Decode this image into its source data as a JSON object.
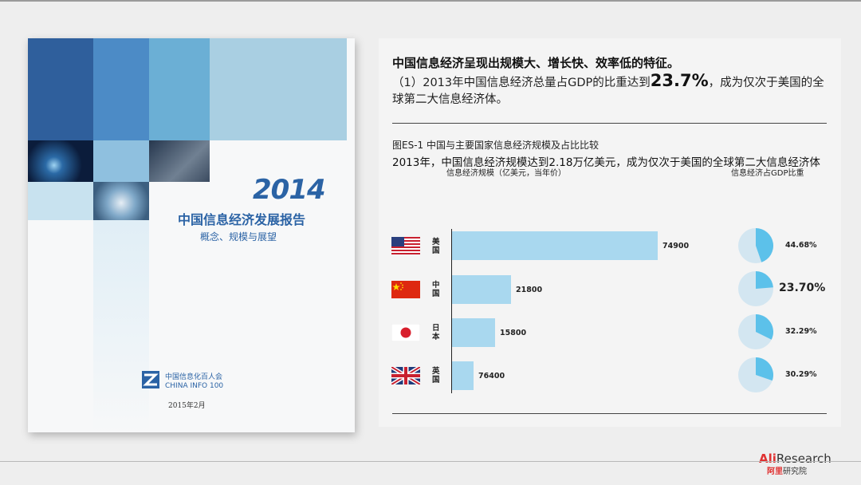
{
  "cover": {
    "year": "2014",
    "title": "中国信息经济发展报告",
    "subtitle": "概念、规模与展望",
    "org_cn": "中国信息化百人会",
    "org_en": "CHINA INFO 100",
    "date": "2015年2月"
  },
  "headline": "中国信息经济呈现出规模大、增长快、效率低的特征。",
  "summary": {
    "before": "（1）2013年中国信息经济总量占GDP的比重达到",
    "highlight": "23.7%",
    "after": "，成为仅次于美国的全球第二大信息经济体。"
  },
  "figure": {
    "label": "图ES-1  中国与主要国家信息经济规模及占比比较",
    "description": "2013年，中国信息经济规模达到2.18万亿美元，成为仅次于美国的全球第二大信息经济体",
    "col_scale": "信息经济规模（亿美元，当年价）",
    "col_share": "信息经济占GDP比重"
  },
  "chart_data": {
    "type": "bar",
    "categories": [
      "美国",
      "中国",
      "日本",
      "英国"
    ],
    "series": [
      {
        "values": [
          74900,
          21800,
          15800,
          76400
        ]
      },
      {
        "values": [
          44.68,
          23.7,
          32.29,
          30.29
        ]
      }
    ],
    "value_labels": [
      "74900",
      "21800",
      "15800",
      "76400"
    ],
    "share_labels": [
      "44.68%",
      "23.70%",
      "32.29%",
      "30.29%"
    ],
    "bar_color": "#a9d8ef",
    "pie_color": "#5cc1ea",
    "pie_bg": "#d3e6f1"
  },
  "logo": {
    "ali": "Ali",
    "research": "Research",
    "cn_red": "阿里",
    "cn_dark": "研究院"
  },
  "colors": {
    "brand_blue": "#2b63a5",
    "logo_red": "#e03232"
  }
}
